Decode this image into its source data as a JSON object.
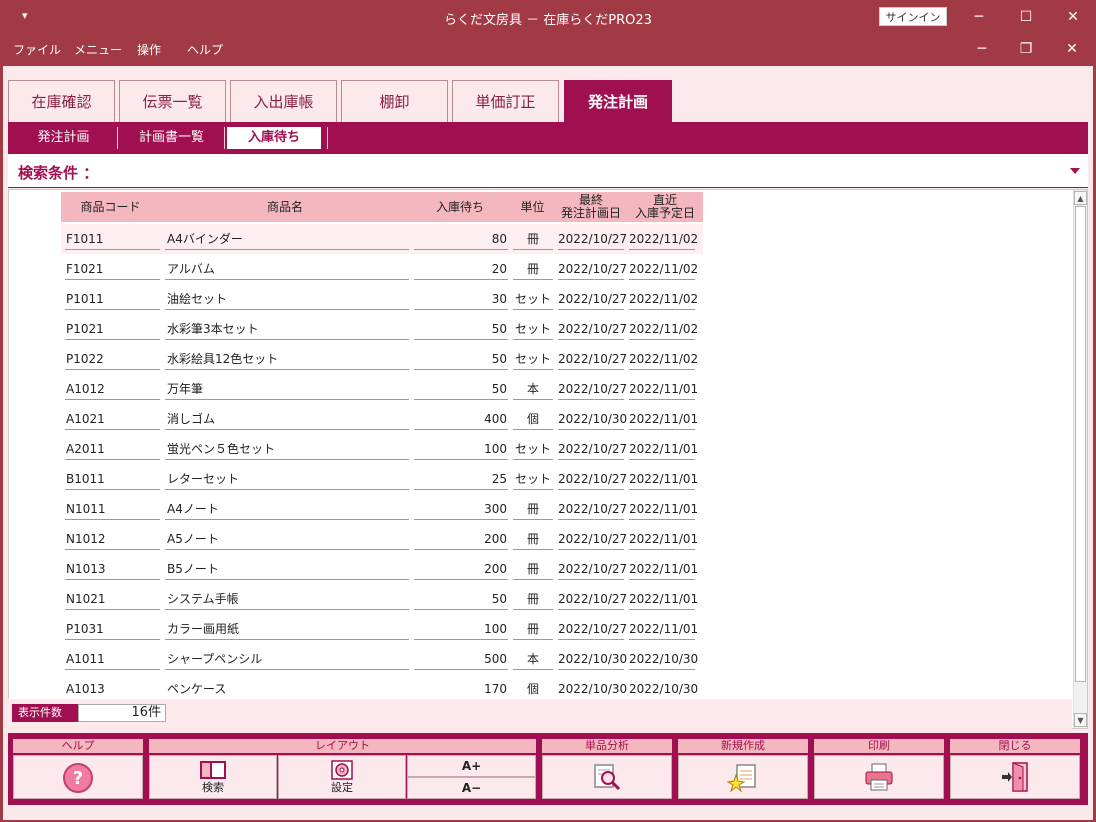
{
  "window": {
    "title": "らくだ文房具 － 在庫らくだPRO23",
    "signin_label": "サインイン",
    "sysmenu_glyph": "▾",
    "minimize_glyph": "─",
    "maximize_glyph": "☐",
    "close_glyph": "✕"
  },
  "menubar": {
    "items": [
      "ファイル",
      "メニュー",
      "操作",
      "ヘルプ"
    ],
    "restore_glyph": "❐"
  },
  "tabs": [
    "在庫確認",
    "伝票一覧",
    "入出庫帳",
    "棚卸",
    "単価訂正",
    "発注計画"
  ],
  "active_tab": "発注計画",
  "subtabs": [
    "発注計画",
    "計画書一覧",
    "入庫待ち"
  ],
  "active_subtab": "入庫待ち",
  "search": {
    "label": "検索条件 ："
  },
  "table": {
    "headers": {
      "code": "商品コード",
      "name": "商品名",
      "qty": "入庫待ち",
      "unit": "単位",
      "plan_line1": "最終",
      "plan_line2": "発注計画日",
      "due_line1": "直近",
      "due_line2": "入庫予定日"
    },
    "rows": [
      {
        "code": "F1011",
        "name": "A4バインダー",
        "qty": "80",
        "unit": "冊",
        "plan": "2022/10/27",
        "due": "2022/11/02"
      },
      {
        "code": "F1021",
        "name": "アルバム",
        "qty": "20",
        "unit": "冊",
        "plan": "2022/10/27",
        "due": "2022/11/02"
      },
      {
        "code": "P1011",
        "name": "油絵セット",
        "qty": "30",
        "unit": "セット",
        "plan": "2022/10/27",
        "due": "2022/11/02"
      },
      {
        "code": "P1021",
        "name": "水彩筆3本セット",
        "qty": "50",
        "unit": "セット",
        "plan": "2022/10/27",
        "due": "2022/11/02"
      },
      {
        "code": "P1022",
        "name": "水彩絵具12色セット",
        "qty": "50",
        "unit": "セット",
        "plan": "2022/10/27",
        "due": "2022/11/02"
      },
      {
        "code": "A1012",
        "name": "万年筆",
        "qty": "50",
        "unit": "本",
        "plan": "2022/10/27",
        "due": "2022/11/01"
      },
      {
        "code": "A1021",
        "name": "消しゴム",
        "qty": "400",
        "unit": "個",
        "plan": "2022/10/30",
        "due": "2022/11/01"
      },
      {
        "code": "A2011",
        "name": "蛍光ペン５色セット",
        "qty": "100",
        "unit": "セット",
        "plan": "2022/10/27",
        "due": "2022/11/01"
      },
      {
        "code": "B1011",
        "name": "レターセット",
        "qty": "25",
        "unit": "セット",
        "plan": "2022/10/27",
        "due": "2022/11/01"
      },
      {
        "code": "N1011",
        "name": "A4ノート",
        "qty": "300",
        "unit": "冊",
        "plan": "2022/10/27",
        "due": "2022/11/01"
      },
      {
        "code": "N1012",
        "name": "A5ノート",
        "qty": "200",
        "unit": "冊",
        "plan": "2022/10/27",
        "due": "2022/11/01"
      },
      {
        "code": "N1013",
        "name": "B5ノート",
        "qty": "200",
        "unit": "冊",
        "plan": "2022/10/27",
        "due": "2022/11/01"
      },
      {
        "code": "N1021",
        "name": "システム手帳",
        "qty": "50",
        "unit": "冊",
        "plan": "2022/10/27",
        "due": "2022/11/01"
      },
      {
        "code": "P1031",
        "name": "カラー画用紙",
        "qty": "100",
        "unit": "冊",
        "plan": "2022/10/27",
        "due": "2022/11/01"
      },
      {
        "code": "A1011",
        "name": "シャープペンシル",
        "qty": "500",
        "unit": "本",
        "plan": "2022/10/30",
        "due": "2022/10/30"
      },
      {
        "code": "A1013",
        "name": "ペンケース",
        "qty": "170",
        "unit": "個",
        "plan": "2022/10/30",
        "due": "2022/10/30"
      }
    ]
  },
  "count": {
    "label": "表示件数",
    "value": "16件"
  },
  "footer": {
    "help": {
      "header": "ヘルプ",
      "icon": "question-icon"
    },
    "layout": {
      "header": "レイアウト",
      "search_label": "検索",
      "settings_label": "設定",
      "font_up": "A+",
      "font_down": "A−"
    },
    "analysis": {
      "header": "単品分析",
      "icon": "magnifier-report-icon"
    },
    "create": {
      "header": "新規作成",
      "icon": "new-document-icon"
    },
    "print": {
      "header": "印刷",
      "icon": "printer-icon"
    },
    "close": {
      "header": "閉じる",
      "icon": "exit-door-icon"
    }
  },
  "colors": {
    "title_bar": "#a23a46",
    "accent": "#a01050",
    "header_pink": "#f5b7bf",
    "panel_bg": "#fbe9ec"
  }
}
